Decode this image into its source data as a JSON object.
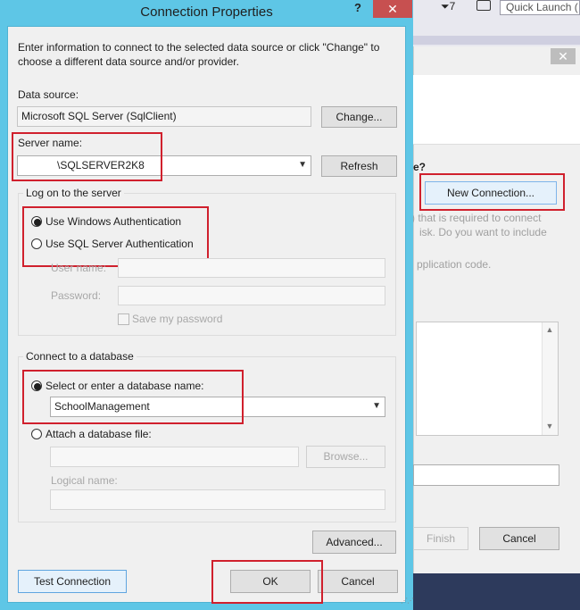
{
  "background": {
    "filter_count": "7",
    "quick_launch_placeholder": "Quick Launch (",
    "close_symbol": "✕",
    "question_fragment": "e?",
    "new_connection_label": "New Connection...",
    "text_line1": ") that is required to connect",
    "text_line2": "isk. Do you want to include",
    "text_line3": "pplication code.",
    "finish_label": "Finish",
    "cancel_label": "Cancel"
  },
  "dialog": {
    "title": "Connection Properties",
    "help_symbol": "?",
    "close_symbol": "✕",
    "intro": "Enter information to connect to the selected data source or click \"Change\" to choose a different data source and/or provider.",
    "data_source": {
      "label": "Data source:",
      "value": "Microsoft SQL Server (SqlClient)",
      "change_label": "Change..."
    },
    "server": {
      "label": "Server name:",
      "value": "\\SQLSERVER2K8",
      "refresh_label": "Refresh"
    },
    "logon": {
      "group_label": "Log on to the server",
      "windows_auth_label": "Use Windows Authentication",
      "sql_auth_label": "Use SQL Server Authentication",
      "username_label": "User name:",
      "password_label": "Password:",
      "save_password_label": "Save my password"
    },
    "database": {
      "group_label": "Connect to a database",
      "select_label": "Select or enter a database name:",
      "db_value": "SchoolManagement",
      "attach_label": "Attach a database file:",
      "browse_label": "Browse...",
      "logical_name_label": "Logical name:"
    },
    "advanced_label": "Advanced...",
    "test_connection_label": "Test Connection",
    "ok_label": "OK",
    "cancel_label": "Cancel"
  },
  "colors": {
    "title_bar": "#5ec6e6",
    "close_button": "#c75050",
    "highlight": "#d0202d"
  }
}
